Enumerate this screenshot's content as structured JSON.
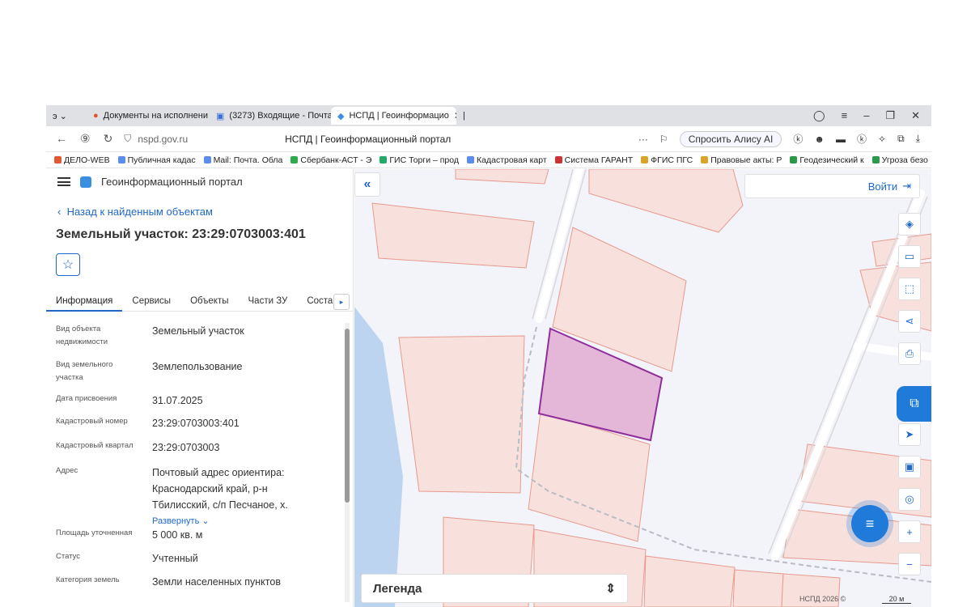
{
  "browser": {
    "tabs": [
      {
        "label": "Документы на исполнени"
      },
      {
        "label": "(3273) Входящие - Почта"
      },
      {
        "label": "НСПД | Геоинформацио"
      }
    ],
    "url": "nspd.gov.ru",
    "page_title": "НСПД | Геоинформационный портал",
    "alisa_label": "Спросить Алису AI",
    "bookmarks": [
      "ДЕЛО-WEB",
      "Публичная кадас",
      "Mail: Почта. Обла",
      "Сбербанк-АСТ - Э",
      "ГИС Торги – прод",
      "Кадастровая карт",
      "Система ГАРАНТ",
      "ФГИС ПГС",
      "Правовые акты: Р",
      "Геодезический к",
      "Угроза безо"
    ]
  },
  "sidebar": {
    "portal_title": "Геоинформационный портал",
    "back_link": "Назад к найденным объектам",
    "object_title": "Земельный участок: 23:29:0703003:401",
    "tabs": [
      "Информация",
      "Сервисы",
      "Объекты",
      "Части ЗУ",
      "Состав"
    ],
    "properties": [
      {
        "key": "Вид объекта недвижимости",
        "value": "Земельный участок"
      },
      {
        "key": "Вид земельного участка",
        "value": "Землепользование"
      },
      {
        "key": "Дата присвоения",
        "value": "31.07.2025"
      },
      {
        "key": "Кадастровый номер",
        "value": "23:29:0703003:401"
      },
      {
        "key": "Кадастровый квартал",
        "value": "23:29:0703003"
      },
      {
        "key": "Адрес",
        "value": "Почтовый адрес ориентира: Краснодарский край, р-н Тбилисский, с/п Песчаное, х."
      },
      {
        "key": "Площадь уточненная",
        "value": "5 000 кв. м"
      },
      {
        "key": "Статус",
        "value": "Учтенный"
      },
      {
        "key": "Категория земель",
        "value": "Земли населенных пунктов"
      }
    ],
    "expand_label": "Развернуть"
  },
  "map": {
    "login_label": "Войти",
    "legend_label": "Легенда",
    "attribution": "НСПД 2026 ©",
    "scale": "20 м",
    "parcel_fill": "#f8e1dc",
    "parcel_stroke": "#e79a8e",
    "selected_fill": "#e4b6d8",
    "selected_stroke": "#8e2e9c",
    "water_color": "#bcd4f0",
    "accent": "#1f7ad9"
  }
}
